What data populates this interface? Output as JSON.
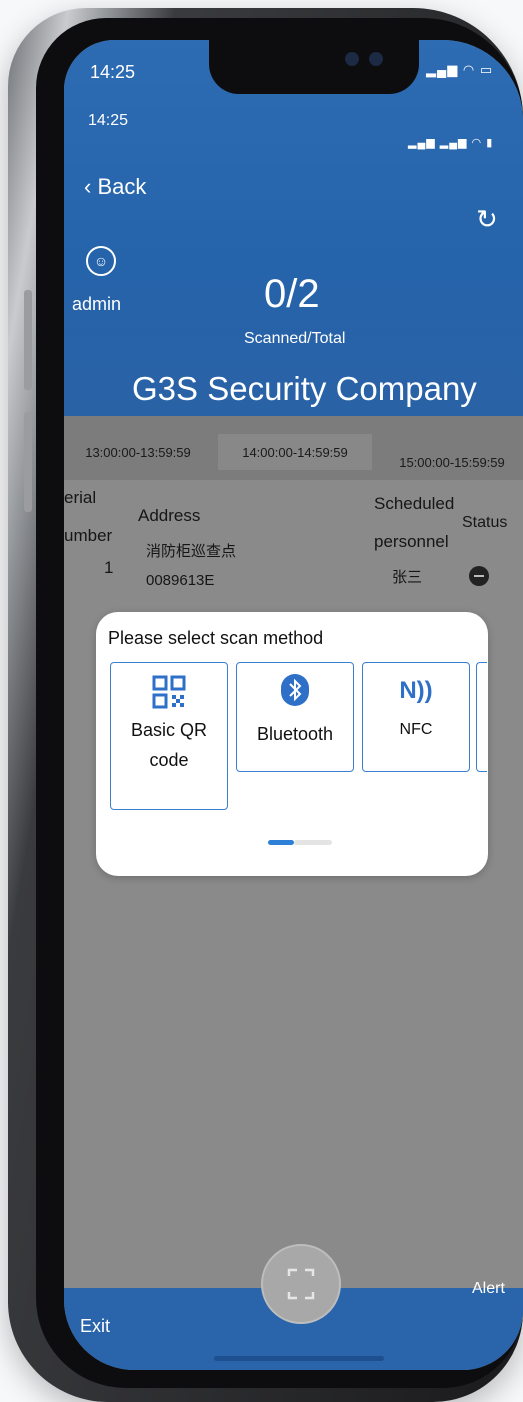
{
  "status_bar": {
    "time_outer": "14:25",
    "time_inner": "14:25"
  },
  "nav": {
    "back_label": "Back",
    "user_label": "admin"
  },
  "progress": {
    "count": "0/2",
    "caption": "Scanned/Total"
  },
  "company": "G3S Security Company",
  "time_tabs": [
    "13:00:00-13:59:59",
    "14:00:00-14:59:59",
    "15:00:00-15:59:59"
  ],
  "table": {
    "headers": {
      "serial_line1": "erial",
      "serial_line2": "umber",
      "address": "Address",
      "personnel_line1": "Scheduled",
      "personnel_line2": "personnel",
      "status": "Status"
    },
    "rows": [
      {
        "serial": "1",
        "address_name": "消防柜巡查点",
        "address_code": "0089613E",
        "personnel": "张三"
      }
    ]
  },
  "scan_modal": {
    "title": "Please select scan method",
    "options": [
      {
        "line1": "Basic QR",
        "line2": "code",
        "icon": "qr-code-icon"
      },
      {
        "line1": "Bluetooth",
        "line2": "",
        "icon": "bluetooth-icon"
      },
      {
        "line1": "NFC",
        "line2": "",
        "icon": "nfc-icon"
      }
    ],
    "page_index": 1,
    "page_count": 2
  },
  "bottom_bar": {
    "exit_label": "Exit",
    "alert_label": "Alert"
  },
  "colors": {
    "brand_blue": "#2563aa",
    "option_border": "#3b7fd0",
    "overlay_gray": "#8a8a8a"
  }
}
